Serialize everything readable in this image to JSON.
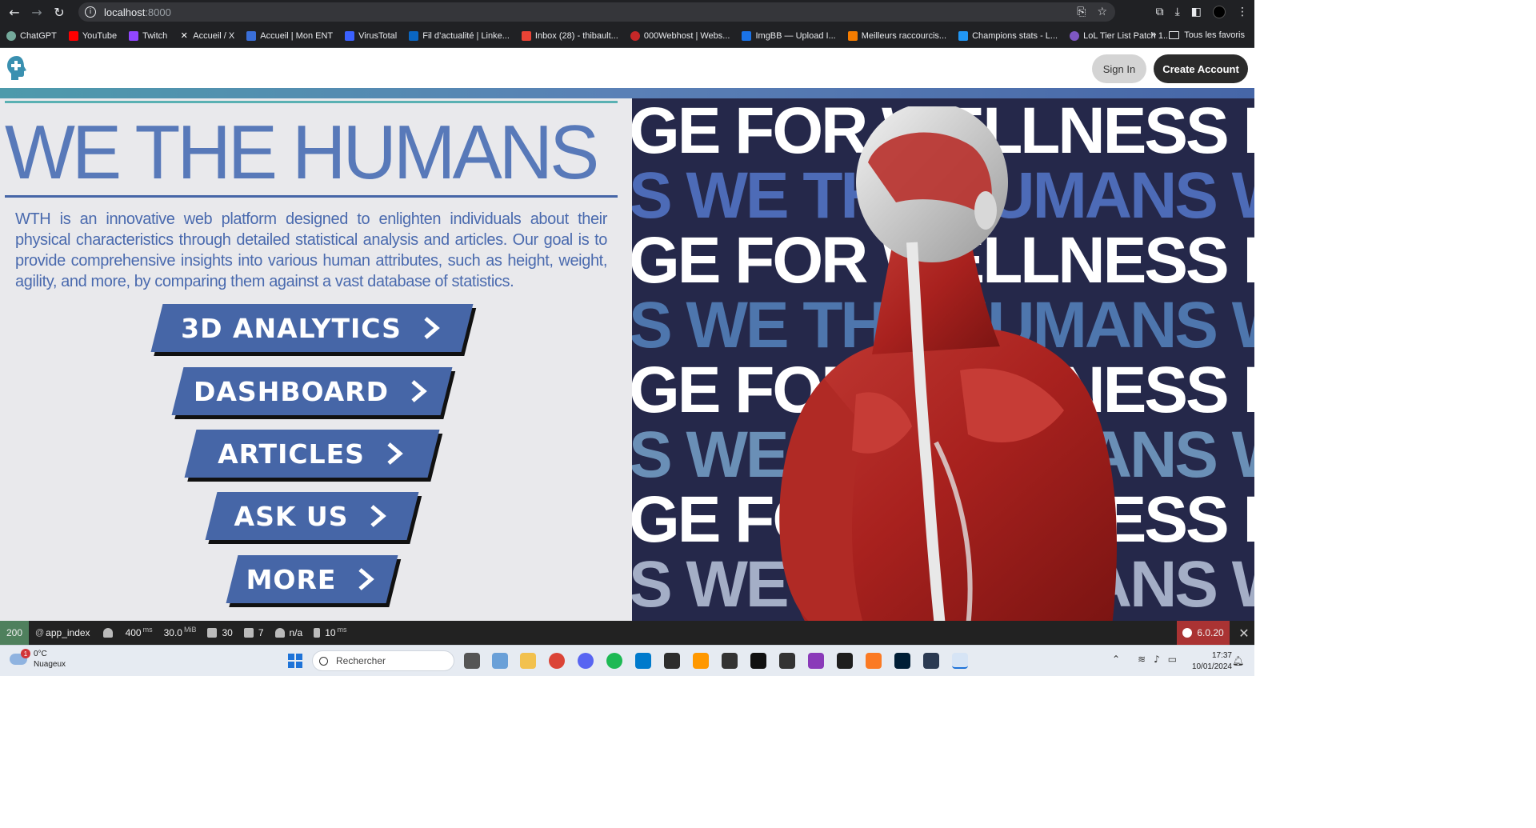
{
  "browser": {
    "url_host": "localhost",
    "url_port": ":8000",
    "bookmarks": [
      {
        "label": "ChatGPT",
        "color": "#74aa9c"
      },
      {
        "label": "YouTube",
        "color": "#ff0000"
      },
      {
        "label": "Twitch",
        "color": "#9146ff"
      },
      {
        "label": "Accueil / X",
        "color": "#ffffff"
      },
      {
        "label": "Accueil | Mon ENT",
        "color": "#3a6fd8"
      },
      {
        "label": "VirusTotal",
        "color": "#3b61ff"
      },
      {
        "label": "Fil d’actualité | Linke...",
        "color": "#0a66c2"
      },
      {
        "label": "Inbox (28) - thibault...",
        "color": "#ea4335"
      },
      {
        "label": "000Webhost | Webs...",
        "color": "#c62828"
      },
      {
        "label": "ImgBB — Upload I...",
        "color": "#1a73e8"
      },
      {
        "label": "Meilleurs raccourcis...",
        "color": "#f57c00"
      },
      {
        "label": "Champions stats - L...",
        "color": "#2196f3"
      },
      {
        "label": "LoL Tier List Patch 1...",
        "color": "#7e57c2"
      }
    ],
    "more_chevron": "»",
    "all_bookmarks": "Tous les favoris"
  },
  "header": {
    "signin_label": "Sign In",
    "create_label": "Create Account"
  },
  "hero": {
    "title": "WE THE HUMANS",
    "description": "WTH is an innovative web platform designed to enlighten individuals about their physical characteristics through detailed statistical analysis and articles. Our goal is to provide comprehensive insights into various human attributes, such as height, weight, agility, and more, by comparing them against a vast database of statistics.",
    "buttons": [
      {
        "label": "3D ANALYTICS"
      },
      {
        "label": "DASHBOARD"
      },
      {
        "label": "ARTICLES"
      },
      {
        "label": "ASK US"
      },
      {
        "label": "MORE"
      }
    ],
    "marquee_white": "GE FOR WELLNESS KN",
    "marquee_blue": "S WE THE HUMANS W"
  },
  "profiler": {
    "status": "200",
    "route": "app_index",
    "time_value": "400",
    "time_unit": "ms",
    "memory_value": "30.0",
    "memory_unit": "MiB",
    "queries": "30",
    "cache": "7",
    "user": "n/a",
    "init_value": "10",
    "init_unit": "ms",
    "version": "6.0.20",
    "close": "✕"
  },
  "taskbar": {
    "weather_temp": "0°C",
    "weather_desc": "Nuageux",
    "weather_badge": "1",
    "search_placeholder": "Rechercher",
    "time": "17:37",
    "date": "10/01/2024"
  },
  "colors": {
    "brand_blue": "#4666a7",
    "title_blue": "#5879b9",
    "panel_navy": "#25284a",
    "accent_teal": "#5ab1b3"
  }
}
